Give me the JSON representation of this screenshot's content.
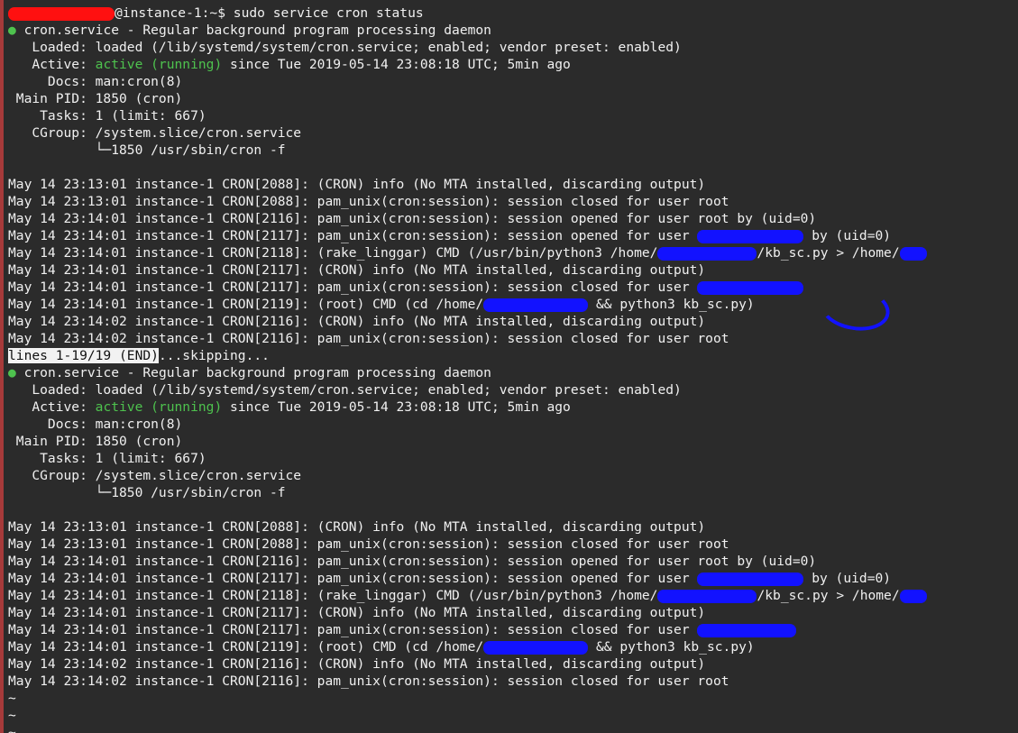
{
  "terminal": {
    "lines": [
      {
        "segments": [
          {
            "text": "",
            "style": "redact-red",
            "w": 118
          },
          {
            "text": "@instance-1:~$ sudo service cron status",
            "style": ""
          }
        ]
      },
      {
        "segments": [
          {
            "text": "●",
            "style": "dot"
          },
          {
            "text": " cron.service - Regular background program processing daemon",
            "style": ""
          }
        ]
      },
      {
        "segments": [
          {
            "text": "   Loaded: loaded (/lib/systemd/system/cron.service; enabled; vendor preset: enabled)",
            "style": ""
          }
        ]
      },
      {
        "segments": [
          {
            "text": "   Active: ",
            "style": ""
          },
          {
            "text": "active (running)",
            "style": "green"
          },
          {
            "text": " since Tue 2019-05-14 23:08:18 UTC; 5min ago",
            "style": ""
          }
        ]
      },
      {
        "segments": [
          {
            "text": "     Docs: man:cron(8)",
            "style": ""
          }
        ]
      },
      {
        "segments": [
          {
            "text": " Main PID: 1850 (cron)",
            "style": ""
          }
        ]
      },
      {
        "segments": [
          {
            "text": "    Tasks: 1 (limit: 667)",
            "style": ""
          }
        ]
      },
      {
        "segments": [
          {
            "text": "   CGroup: /system.slice/cron.service",
            "style": ""
          }
        ]
      },
      {
        "segments": [
          {
            "text": "           └─1850 /usr/sbin/cron -f",
            "style": ""
          }
        ]
      },
      {
        "segments": [
          {
            "text": "",
            "style": ""
          }
        ]
      },
      {
        "segments": [
          {
            "text": "May 14 23:13:01 instance-1 CRON[2088]: (CRON) info (No MTA installed, discarding output)",
            "style": ""
          }
        ]
      },
      {
        "segments": [
          {
            "text": "May 14 23:13:01 instance-1 CRON[2088]: pam_unix(cron:session): session closed for user root",
            "style": ""
          }
        ]
      },
      {
        "segments": [
          {
            "text": "May 14 23:14:01 instance-1 CRON[2116]: pam_unix(cron:session): session opened for user root by (uid=0)",
            "style": ""
          }
        ]
      },
      {
        "segments": [
          {
            "text": "May 14 23:14:01 instance-1 CRON[2117]: pam_unix(cron:session): session opened for user ",
            "style": ""
          },
          {
            "text": "",
            "style": "redact-blue",
            "w": 118
          },
          {
            "text": " by (uid=0)",
            "style": ""
          }
        ]
      },
      {
        "segments": [
          {
            "text": "May 14 23:14:01 instance-1 CRON[2118]: (rake_linggar) CMD (/usr/bin/python3 /home/",
            "style": ""
          },
          {
            "text": "",
            "style": "redact-blue",
            "w": 110
          },
          {
            "text": "/kb_sc.py > /home/",
            "style": ""
          },
          {
            "text": "",
            "style": "redact-blue",
            "w": 30
          }
        ]
      },
      {
        "segments": [
          {
            "text": "May 14 23:14:01 instance-1 CRON[2117]: (CRON) info (No MTA installed, discarding output)",
            "style": ""
          }
        ]
      },
      {
        "segments": [
          {
            "text": "May 14 23:14:01 instance-1 CRON[2117]: pam_unix(cron:session): session closed for user ",
            "style": ""
          },
          {
            "text": "",
            "style": "redact-blue",
            "w": 118
          }
        ]
      },
      {
        "segments": [
          {
            "text": "May 14 23:14:01 instance-1 CRON[2119]: (root) CMD (cd /home/",
            "style": ""
          },
          {
            "text": "",
            "style": "redact-blue",
            "w": 116
          },
          {
            "text": " && python3 kb_sc.py)",
            "style": ""
          }
        ]
      },
      {
        "segments": [
          {
            "text": "May 14 23:14:02 instance-1 CRON[2116]: (CRON) info (No MTA installed, discarding output)",
            "style": ""
          }
        ]
      },
      {
        "segments": [
          {
            "text": "May 14 23:14:02 instance-1 CRON[2116]: pam_unix(cron:session): session closed for user root",
            "style": ""
          }
        ]
      },
      {
        "segments": [
          {
            "text": "lines 1-19/19 (END)",
            "style": "status-bar"
          },
          {
            "text": "...skipping...",
            "style": ""
          }
        ]
      },
      {
        "segments": [
          {
            "text": "●",
            "style": "dot"
          },
          {
            "text": " cron.service - Regular background program processing daemon",
            "style": ""
          }
        ]
      },
      {
        "segments": [
          {
            "text": "   Loaded: loaded (/lib/systemd/system/cron.service; enabled; vendor preset: enabled)",
            "style": ""
          }
        ]
      },
      {
        "segments": [
          {
            "text": "   Active: ",
            "style": ""
          },
          {
            "text": "active (running)",
            "style": "green"
          },
          {
            "text": " since Tue 2019-05-14 23:08:18 UTC; 5min ago",
            "style": ""
          }
        ]
      },
      {
        "segments": [
          {
            "text": "     Docs: man:cron(8)",
            "style": ""
          }
        ]
      },
      {
        "segments": [
          {
            "text": " Main PID: 1850 (cron)",
            "style": ""
          }
        ]
      },
      {
        "segments": [
          {
            "text": "    Tasks: 1 (limit: 667)",
            "style": ""
          }
        ]
      },
      {
        "segments": [
          {
            "text": "   CGroup: /system.slice/cron.service",
            "style": ""
          }
        ]
      },
      {
        "segments": [
          {
            "text": "           └─1850 /usr/sbin/cron -f",
            "style": ""
          }
        ]
      },
      {
        "segments": [
          {
            "text": "",
            "style": ""
          }
        ]
      },
      {
        "segments": [
          {
            "text": "May 14 23:13:01 instance-1 CRON[2088]: (CRON) info (No MTA installed, discarding output)",
            "style": ""
          }
        ]
      },
      {
        "segments": [
          {
            "text": "May 14 23:13:01 instance-1 CRON[2088]: pam_unix(cron:session): session closed for user root",
            "style": ""
          }
        ]
      },
      {
        "segments": [
          {
            "text": "May 14 23:14:01 instance-1 CRON[2116]: pam_unix(cron:session): session opened for user root by (uid=0)",
            "style": ""
          }
        ]
      },
      {
        "segments": [
          {
            "text": "May 14 23:14:01 instance-1 CRON[2117]: pam_unix(cron:session): session opened for user ",
            "style": ""
          },
          {
            "text": "",
            "style": "redact-blue",
            "w": 118
          },
          {
            "text": " by (uid=0)",
            "style": ""
          }
        ]
      },
      {
        "segments": [
          {
            "text": "May 14 23:14:01 instance-1 CRON[2118]: (rake_linggar) CMD (/usr/bin/python3 /home/",
            "style": ""
          },
          {
            "text": "",
            "style": "redact-blue",
            "w": 110
          },
          {
            "text": "/kb_sc.py > /home/",
            "style": ""
          },
          {
            "text": "",
            "style": "redact-blue",
            "w": 30
          }
        ]
      },
      {
        "segments": [
          {
            "text": "May 14 23:14:01 instance-1 CRON[2117]: (CRON) info (No MTA installed, discarding output)",
            "style": ""
          }
        ]
      },
      {
        "segments": [
          {
            "text": "May 14 23:14:01 instance-1 CRON[2117]: pam_unix(cron:session): session closed for user ",
            "style": ""
          },
          {
            "text": "",
            "style": "redact-blue",
            "w": 110
          }
        ]
      },
      {
        "segments": [
          {
            "text": "May 14 23:14:01 instance-1 CRON[2119]: (root) CMD (cd /home/",
            "style": ""
          },
          {
            "text": "",
            "style": "redact-blue",
            "w": 116
          },
          {
            "text": " && python3 kb_sc.py)",
            "style": ""
          }
        ]
      },
      {
        "segments": [
          {
            "text": "May 14 23:14:02 instance-1 CRON[2116]: (CRON) info (No MTA installed, discarding output)",
            "style": ""
          }
        ]
      },
      {
        "segments": [
          {
            "text": "May 14 23:14:02 instance-1 CRON[2116]: pam_unix(cron:session): session closed for user root",
            "style": ""
          }
        ]
      },
      {
        "segments": [
          {
            "text": "~",
            "style": ""
          }
        ]
      },
      {
        "segments": [
          {
            "text": "~",
            "style": ""
          }
        ]
      },
      {
        "segments": [
          {
            "text": "~",
            "style": ""
          }
        ]
      }
    ]
  }
}
